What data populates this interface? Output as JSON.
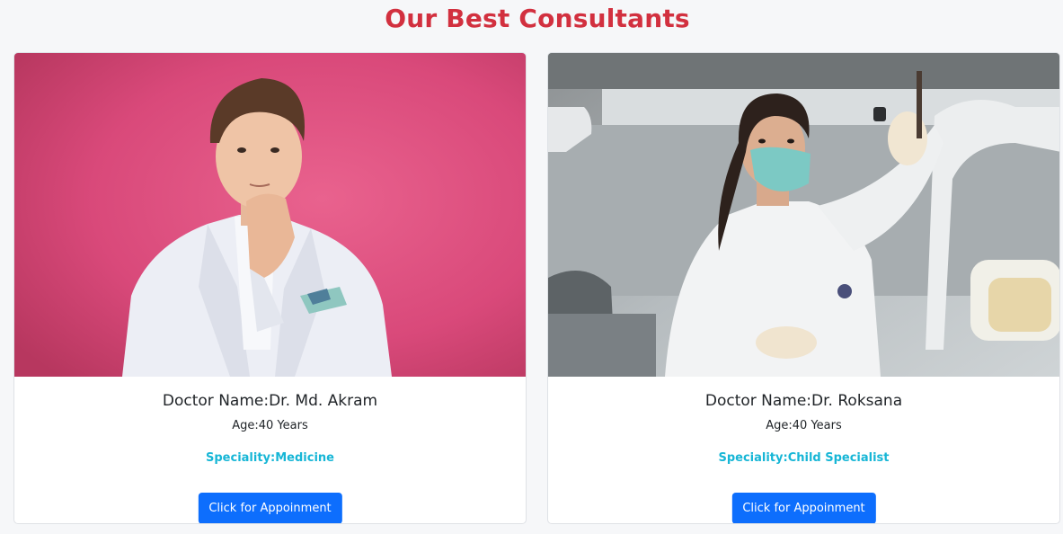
{
  "section": {
    "title": "Our Best Consultants"
  },
  "colors": {
    "title": "#d2303f",
    "speciality": "#17b6d6",
    "button": "#0d6efd"
  },
  "doctors": [
    {
      "photo": "doctor-portrait-photo",
      "name": "Doctor Name:Dr. Md. Akram",
      "age": "Age:40 Years",
      "speciality": "Speciality:Medicine",
      "button_label": "Click for Appoinment"
    },
    {
      "photo": "doctor-lab-photo",
      "name": "Doctor Name:Dr. Roksana",
      "age": "Age:40 Years",
      "speciality": "Speciality:Child Specialist",
      "button_label": "Click for Appoinment"
    }
  ]
}
